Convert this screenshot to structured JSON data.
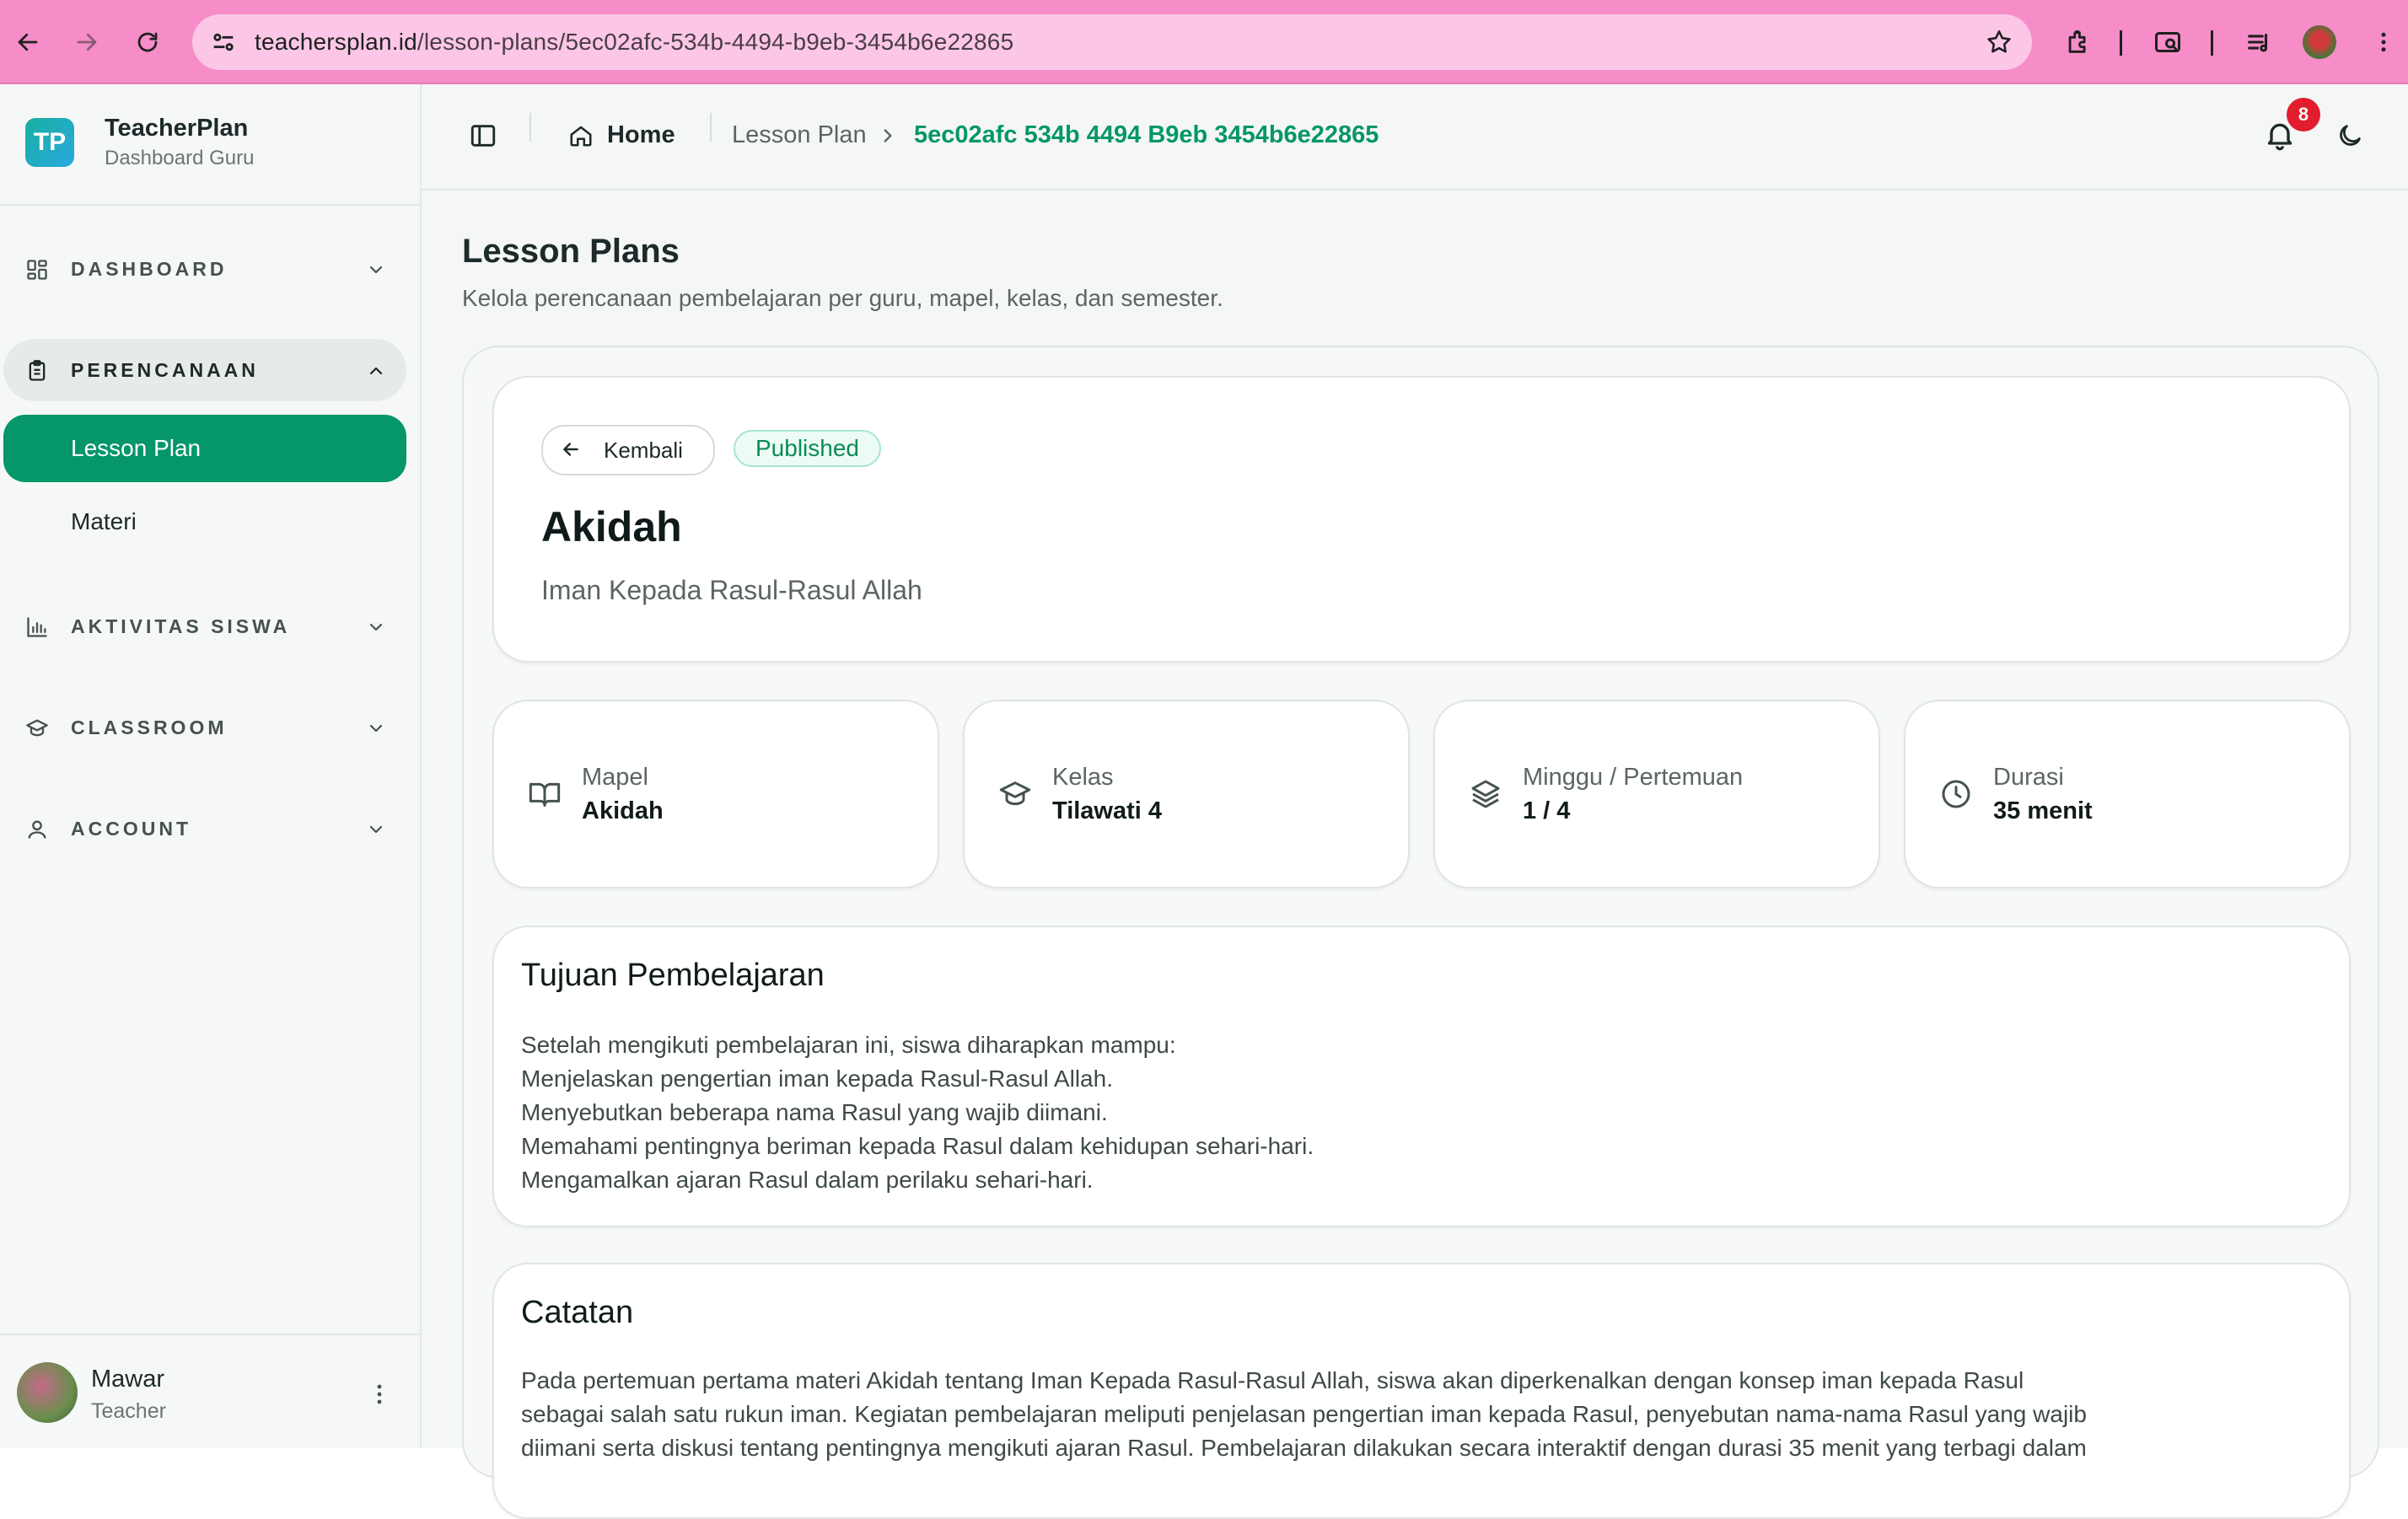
{
  "browser": {
    "url_domain": "teachersplan.id",
    "url_path": "/lesson-plans/5ec02afc-534b-4494-b9eb-3454b6e22865"
  },
  "brand": {
    "logo_text": "TP",
    "name": "TeacherPlan",
    "subtitle": "Dashboard Guru"
  },
  "sidebar": {
    "groups": [
      {
        "label": "DASHBOARD",
        "icon": "dashboard-grid-icon",
        "expanded": false
      },
      {
        "label": "PERENCANAAN",
        "icon": "clipboard-icon",
        "expanded": true
      },
      {
        "label": "AKTIVITAS SISWA",
        "icon": "bar-chart-icon",
        "expanded": false
      },
      {
        "label": "CLASSROOM",
        "icon": "graduation-cap-icon",
        "expanded": false
      },
      {
        "label": "ACCOUNT",
        "icon": "user-icon",
        "expanded": false
      }
    ],
    "sub_items": [
      {
        "label": "Lesson Plan",
        "active": true
      },
      {
        "label": "Materi",
        "active": false
      }
    ]
  },
  "user": {
    "name": "Mawar",
    "role": "Teacher"
  },
  "topbar": {
    "home": "Home",
    "crumb_parent": "Lesson Plan",
    "crumb_current": "5ec02afc 534b 4494 B9eb 3454b6e22865",
    "notification_count": "8"
  },
  "page": {
    "title": "Lesson Plans",
    "subtitle": "Kelola perencanaan pembelajaran per guru, mapel, kelas, dan semester."
  },
  "lesson": {
    "back_label": "Kembali",
    "status": "Published",
    "title": "Akidah",
    "subtitle": "Iman Kepada Rasul-Rasul Allah"
  },
  "stats": [
    {
      "label": "Mapel",
      "value": "Akidah",
      "icon": "book-open-icon"
    },
    {
      "label": "Kelas",
      "value": "Tilawati 4",
      "icon": "graduation-cap-icon"
    },
    {
      "label": "Minggu / Pertemuan",
      "value": "1 / 4",
      "icon": "layers-icon"
    },
    {
      "label": "Durasi",
      "value": "35 menit",
      "icon": "clock-icon"
    }
  ],
  "objectives": {
    "title": "Tujuan Pembelajaran",
    "lines": [
      "Setelah mengikuti pembelajaran ini, siswa diharapkan mampu:",
      "Menjelaskan pengertian iman kepada Rasul-Rasul Allah.",
      "Menyebutkan beberapa nama Rasul yang wajib diimani.",
      "Memahami pentingnya beriman kepada Rasul dalam kehidupan sehari-hari.",
      "Mengamalkan ajaran Rasul dalam perilaku sehari-hari."
    ]
  },
  "notes": {
    "title": "Catatan",
    "lines": [
      "Pada pertemuan pertama materi Akidah tentang Iman Kepada Rasul-Rasul Allah, siswa akan diperkenalkan dengan konsep iman kepada Rasul",
      "sebagai salah satu rukun iman. Kegiatan pembelajaran meliputi penjelasan pengertian iman kepada Rasul, penyebutan nama-nama Rasul yang wajib",
      "diimani serta diskusi tentang pentingnya mengikuti ajaran Rasul. Pembelajaran dilakukan secara interaktif dengan durasi 35 menit yang terbagi dalam"
    ]
  },
  "colors": {
    "browser_frame": "#f68dc8",
    "url_bar": "#fcc7e6",
    "accent": "#059669",
    "badge": "#e11d2e"
  }
}
